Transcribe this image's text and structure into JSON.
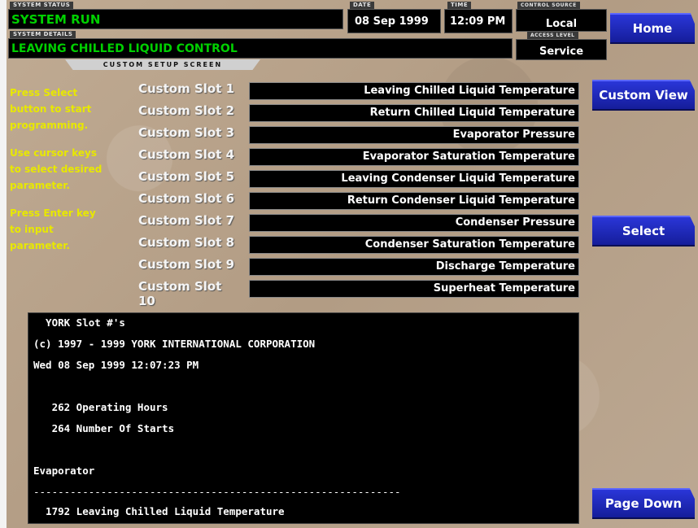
{
  "header": {
    "system_status_label": "SYSTEM STATUS",
    "system_status": "SYSTEM RUN",
    "system_details_label": "SYSTEM DETAILS",
    "system_details": "LEAVING CHILLED LIQUID CONTROL",
    "date_label": "DATE",
    "date": "08 Sep 1999",
    "time_label": "TIME",
    "time": "12:09 PM",
    "control_source_label": "CONTROL SOURCE",
    "control_source": "Local",
    "access_level_label": "ACCESS LEVEL",
    "access_level": "Service",
    "screen_title": "CUSTOM SETUP SCREEN"
  },
  "nav": {
    "home": "Home",
    "custom_view": "Custom View",
    "select": "Select",
    "page_down": "Page Down"
  },
  "instructions": [
    "Press Select",
    "button to start",
    "programming.",
    "Use cursor keys",
    "to select desired",
    "parameter.",
    "Press Enter key",
    "to input",
    "parameter."
  ],
  "slots": [
    {
      "label": "Custom Slot 1",
      "value": "Leaving Chilled Liquid Temperature"
    },
    {
      "label": "Custom Slot 2",
      "value": "Return Chilled Liquid Temperature"
    },
    {
      "label": "Custom Slot 3",
      "value": "Evaporator Pressure"
    },
    {
      "label": "Custom Slot 4",
      "value": "Evaporator Saturation Temperature"
    },
    {
      "label": "Custom Slot 5",
      "value": "Leaving Condenser Liquid Temperature"
    },
    {
      "label": "Custom Slot 6",
      "value": "Return Condenser Liquid Temperature"
    },
    {
      "label": "Custom Slot 7",
      "value": "Condenser Pressure"
    },
    {
      "label": "Custom Slot 8",
      "value": "Condenser Saturation Temperature"
    },
    {
      "label": "Custom Slot 9",
      "value": "Discharge Temperature"
    },
    {
      "label": "Custom Slot 10",
      "value": "Superheat Temperature"
    }
  ],
  "console": {
    "lines": [
      "  YORK Slot #'s",
      "(c) 1997 - 1999 YORK INTERNATIONAL CORPORATION",
      "Wed 08 Sep 1999 12:07:23 PM",
      "",
      "   262 Operating Hours",
      "   264 Number Of Starts",
      "",
      "Evaporator",
      "------------------------------------------------------------",
      "  1792 Leaving Chilled Liquid Temperature"
    ]
  }
}
